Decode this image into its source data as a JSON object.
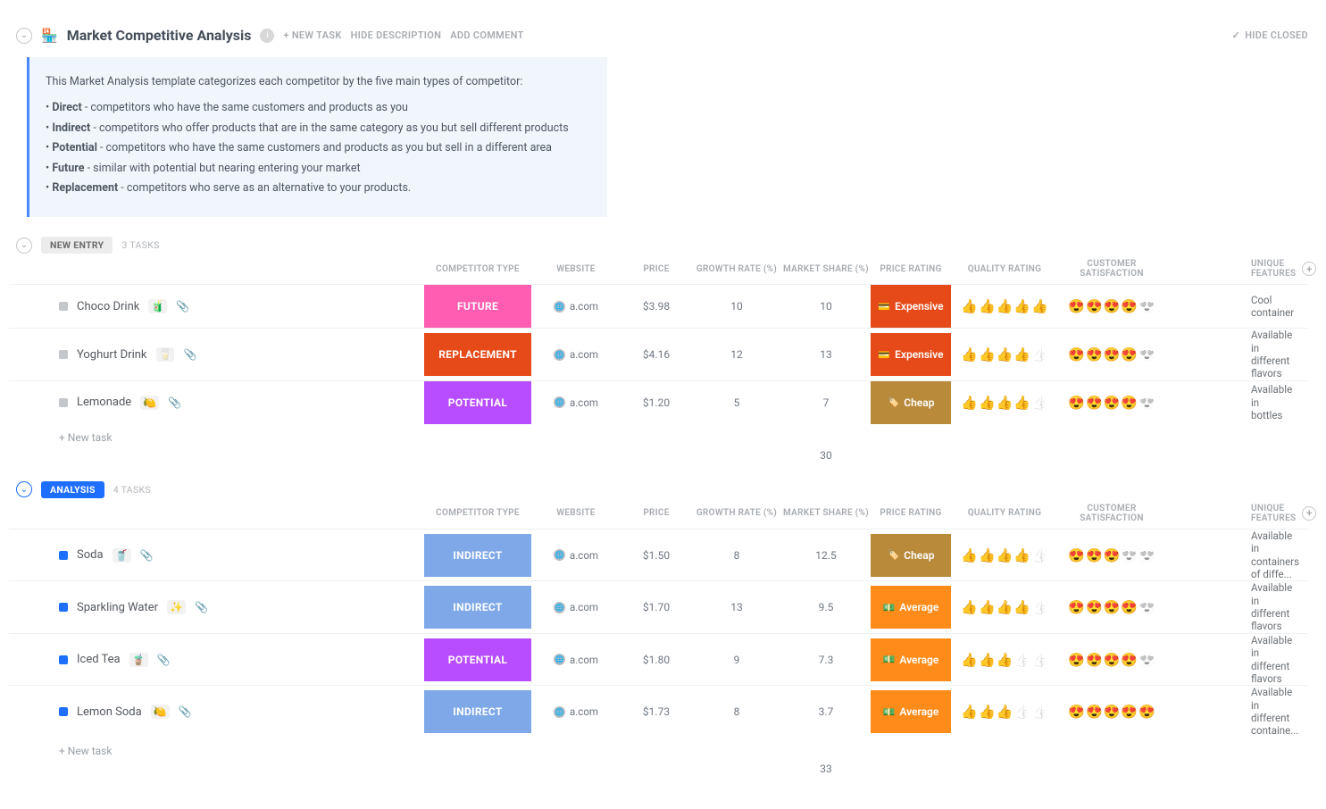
{
  "header": {
    "icon": "🏪",
    "title": "Market Competitive Analysis",
    "new_task_btn": "+ NEW TASK",
    "hide_desc_btn": "HIDE DESCRIPTION",
    "add_comment_btn": "ADD COMMENT",
    "hide_closed_btn": "HIDE CLOSED"
  },
  "description": {
    "intro": "This Market Analysis template categorizes each competitor by the five main types of competitor:",
    "items": [
      {
        "term": "Direct",
        "text": " - competitors who have the same customers and products as you"
      },
      {
        "term": "Indirect",
        "text": " - competitors who offer products that are in the same category as you but sell different products"
      },
      {
        "term": "Potential",
        "text": " - competitors who have the same customers and products as you but sell in a different area"
      },
      {
        "term": "Future",
        "text": " - similar with potential but nearing entering your market"
      },
      {
        "term": "Replacement",
        "text": " - competitors who serve as an alternative to your products."
      }
    ]
  },
  "columns": {
    "competitor_type": "COMPETITOR TYPE",
    "website": "WEBSITE",
    "price": "PRICE",
    "growth_rate": "GROWTH RATE (%)",
    "market_share": "MARKET SHARE (%)",
    "price_rating": "PRICE RATING",
    "quality_rating": "QUALITY RATING",
    "customer_satisfaction": "CUSTOMER SATISFACTION",
    "unique_features": "UNIQUE FEATURES"
  },
  "misc": {
    "new_task_row": "+ New task"
  },
  "groups": [
    {
      "name": "NEW ENTRY",
      "style": "grey",
      "count_label": "3 TASKS",
      "sum_market_share": "30",
      "rows": [
        {
          "status": "grey",
          "name": "Choco Drink",
          "emoji": "🧃",
          "website": "a.com",
          "ctype": "FUTURE",
          "ctype_class": "future",
          "price": "$3.98",
          "growth": "10",
          "share": "10",
          "prating": "Expensive",
          "prating_class": "expensive",
          "prating_icon": "💳",
          "quality": 5,
          "satisfaction": 4,
          "features": "Cool container"
        },
        {
          "status": "grey",
          "name": "Yoghurt Drink",
          "emoji": "🥛",
          "website": "a.com",
          "ctype": "REPLACEMENT",
          "ctype_class": "replacement",
          "price": "$4.16",
          "growth": "12",
          "share": "13",
          "prating": "Expensive",
          "prating_class": "expensive",
          "prating_icon": "💳",
          "quality": 4,
          "satisfaction": 4,
          "features": "Available in different flavors"
        },
        {
          "status": "grey",
          "name": "Lemonade",
          "emoji": "🍋",
          "website": "a.com",
          "ctype": "POTENTIAL",
          "ctype_class": "potential",
          "price": "$1.20",
          "growth": "5",
          "share": "7",
          "prating": "Cheap",
          "prating_class": "cheap",
          "prating_icon": "🏷️",
          "quality": 4,
          "satisfaction": 4,
          "features": "Available in bottles"
        }
      ]
    },
    {
      "name": "ANALYSIS",
      "style": "blue",
      "count_label": "4 TASKS",
      "sum_market_share": "33",
      "rows": [
        {
          "status": "blue",
          "name": "Soda",
          "emoji": "🥤",
          "website": "a.com",
          "ctype": "INDIRECT",
          "ctype_class": "indirect",
          "price": "$1.50",
          "growth": "8",
          "share": "12.5",
          "prating": "Cheap",
          "prating_class": "cheap",
          "prating_icon": "🏷️",
          "quality": 4,
          "satisfaction": 3,
          "features": "Available in containers of diffe..."
        },
        {
          "status": "blue",
          "name": "Sparkling Water",
          "emoji": "✨",
          "website": "a.com",
          "ctype": "INDIRECT",
          "ctype_class": "indirect",
          "price": "$1.70",
          "growth": "13",
          "share": "9.5",
          "prating": "Average",
          "prating_class": "average",
          "prating_icon": "💵",
          "quality": 4,
          "satisfaction": 4,
          "features": "Available in different flavors"
        },
        {
          "status": "blue",
          "name": "Iced Tea",
          "emoji": "🧋",
          "website": "a.com",
          "ctype": "POTENTIAL",
          "ctype_class": "potential",
          "price": "$1.80",
          "growth": "9",
          "share": "7.3",
          "prating": "Average",
          "prating_class": "average",
          "prating_icon": "💵",
          "quality": 3,
          "satisfaction": 4,
          "features": "Available in different flavors"
        },
        {
          "status": "blue",
          "name": "Lemon Soda",
          "emoji": "🍋",
          "website": "a.com",
          "ctype": "INDIRECT",
          "ctype_class": "indirect",
          "price": "$1.73",
          "growth": "8",
          "share": "3.7",
          "prating": "Average",
          "prating_class": "average",
          "prating_icon": "💵",
          "quality": 3,
          "satisfaction": 5,
          "features": "Available in different containe..."
        }
      ]
    }
  ]
}
